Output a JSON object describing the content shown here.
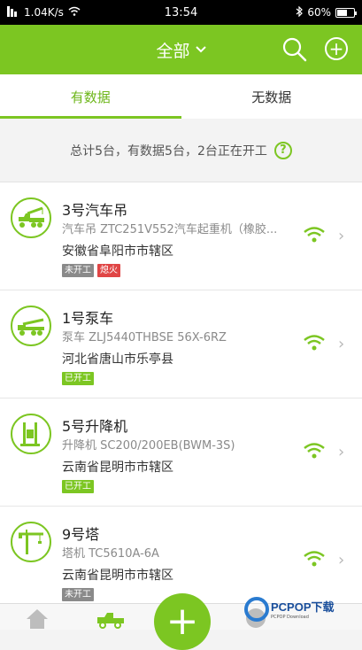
{
  "status_bar": {
    "network_speed": "1.04K/s",
    "time": "13:54",
    "battery": "60%",
    "battery_level": 0.6
  },
  "header": {
    "title": "全部"
  },
  "tabs": [
    {
      "label": "有数据"
    },
    {
      "label": "无数据"
    }
  ],
  "summary": {
    "text": "总计5台，有数据5台，2台正在开工",
    "help": "?"
  },
  "items": [
    {
      "name": "3号汽车吊",
      "model": "汽车吊 ZTC251V552汽车起重机（橡胶...",
      "location": "安徽省阜阳市市辖区",
      "tags": [
        {
          "label": "未开工",
          "color": "#8a8a8a"
        },
        {
          "label": "熄火",
          "color": "#e04545"
        }
      ]
    },
    {
      "name": "1号泵车",
      "model": "泵车 ZLJ5440THBSE 56X-6RZ",
      "location": "河北省唐山市乐亭县",
      "tags": [
        {
          "label": "已开工",
          "color": "#7cc622"
        }
      ]
    },
    {
      "name": "5号升降机",
      "model": "升降机 SC200/200EB(BWM-3S)",
      "location": "云南省昆明市市辖区",
      "tags": [
        {
          "label": "已开工",
          "color": "#7cc622"
        }
      ]
    },
    {
      "name": "9号塔",
      "model": "塔机 TC5610A-6A",
      "location": "云南省昆明市市辖区",
      "tags": [
        {
          "label": "未开工",
          "color": "#8a8a8a"
        }
      ]
    }
  ],
  "fab": {
    "label": "+"
  },
  "watermark": {
    "text": "PCPOP下载",
    "sub": "PCPOP Download"
  },
  "colors": {
    "accent": "#7cc622"
  }
}
